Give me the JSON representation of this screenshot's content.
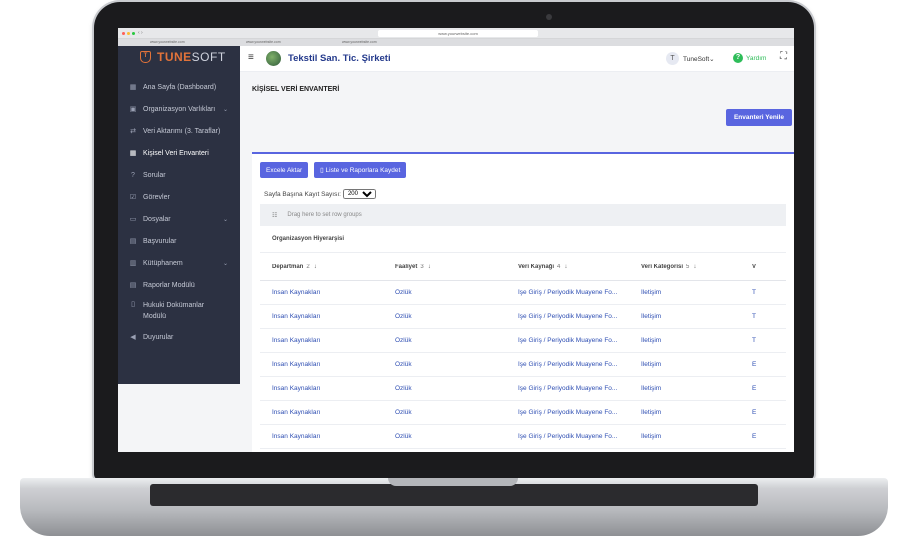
{
  "browser": {
    "url": "www.yourwebsite.com",
    "tabs": [
      "www.yourwebsite.com",
      "www.yourwebsite.com",
      "www.yourwebsite.com"
    ]
  },
  "sidebar": {
    "logo_primary": "TUNE",
    "logo_secondary": "SOFT",
    "items": [
      {
        "label": "Ana Sayfa (Dashboard)",
        "icon": "dashboard-icon"
      },
      {
        "label": "Organizasyon Varlıkları",
        "icon": "organization-icon",
        "expandable": true
      },
      {
        "label": "Veri Aktarımı (3. Taraflar)",
        "icon": "transfer-icon"
      },
      {
        "label": "Kişisel Veri Envanteri",
        "icon": "table-icon",
        "active": true
      },
      {
        "label": "Sorular",
        "icon": "question-icon"
      },
      {
        "label": "Görevler",
        "icon": "task-icon"
      },
      {
        "label": "Dosyalar",
        "icon": "folder-icon",
        "expandable": true
      },
      {
        "label": "Başvurular",
        "icon": "application-icon"
      },
      {
        "label": "Kütüphanem",
        "icon": "library-icon",
        "expandable": true
      },
      {
        "label": "Raporlar Modülü",
        "icon": "report-icon"
      },
      {
        "label": "Hukuki Dokümanlar",
        "label2": "Modülü",
        "icon": "document-icon"
      },
      {
        "label": "Duyurular",
        "icon": "announcement-icon"
      }
    ]
  },
  "header": {
    "company": "Tekstil San. Tic. Şirketi",
    "user_initial": "T",
    "user_name": "TuneSoft",
    "help": "Yardım"
  },
  "main": {
    "title": "KİŞİSEL VERİ ENVANTERİ",
    "refresh_button": "Envanteri Yenile",
    "export_button": "Excele Aktar",
    "save_button": "Liste ve Raporlara Kaydet",
    "page_size_label": "Sayfa Başına Kayıt Sayısı:",
    "page_size_value": "200",
    "group_hint": "Drag here to set row groups",
    "group_header": "Organizasyon Hiyerarşisi",
    "columns": [
      {
        "label": "Departman",
        "order": "2"
      },
      {
        "label": "Faaliyet",
        "order": "3"
      },
      {
        "label": "Veri Kaynağı",
        "order": "4"
      },
      {
        "label": "Veri Kategorisi",
        "order": "5"
      },
      {
        "label": "V",
        "order": ""
      }
    ],
    "rows": [
      [
        "İnsan Kaynakları",
        "Özlük",
        "İşe Giriş / Periyodik Muayene Fo...",
        "İletişim",
        "T"
      ],
      [
        "İnsan Kaynakları",
        "Özlük",
        "İşe Giriş / Periyodik Muayene Fo...",
        "İletişim",
        "T"
      ],
      [
        "İnsan Kaynakları",
        "Özlük",
        "İşe Giriş / Periyodik Muayene Fo...",
        "İletişim",
        "T"
      ],
      [
        "İnsan Kaynakları",
        "Özlük",
        "İşe Giriş / Periyodik Muayene Fo...",
        "İletişim",
        "E"
      ],
      [
        "İnsan Kaynakları",
        "Özlük",
        "İşe Giriş / Periyodik Muayene Fo...",
        "İletişim",
        "E"
      ],
      [
        "İnsan Kaynakları",
        "Özlük",
        "İşe Giriş / Periyodik Muayene Fo...",
        "İletişim",
        "E"
      ],
      [
        "İnsan Kaynakları",
        "Özlük",
        "İşe Giriş / Periyodik Muayene Fo...",
        "İletişim",
        "E"
      ]
    ]
  },
  "colors": {
    "accent": "#5965e0",
    "sidebar_bg": "#2c3142",
    "brand_orange": "#e2733a",
    "company_blue": "#243a8c",
    "link_blue": "#2f4fb3",
    "help_green": "#2ebd59"
  }
}
